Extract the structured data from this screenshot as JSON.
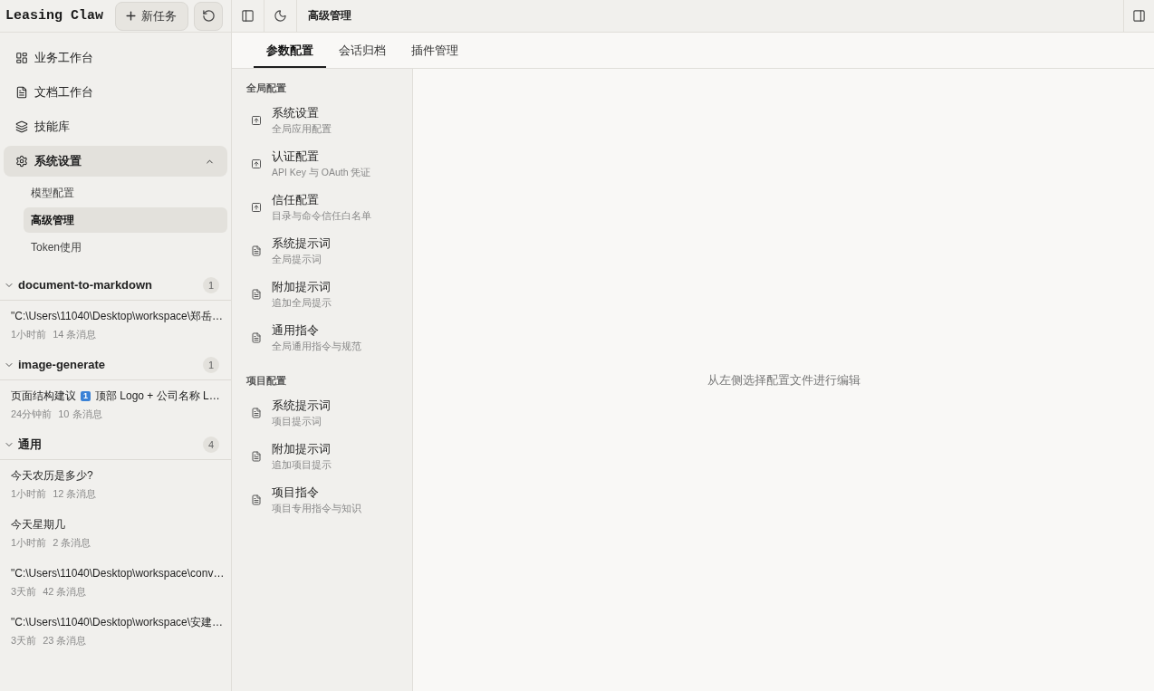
{
  "app_header": {
    "title": "Leasing Claw",
    "new_task_button": "新任务"
  },
  "toolbar": {
    "title": "高级管理"
  },
  "nav": [
    {
      "label": "业务工作台",
      "selected": false
    },
    {
      "label": "文档工作台",
      "selected": false
    },
    {
      "label": "技能库",
      "selected": false
    },
    {
      "label": "系统设置",
      "selected": true,
      "expanded": true,
      "children": [
        {
          "label": "模型配置",
          "selected": false
        },
        {
          "label": "高级管理",
          "selected": true
        },
        {
          "label": "Token使用",
          "selected": false
        }
      ]
    }
  ],
  "session_groups": [
    {
      "name": "document-to-markdown",
      "count": "1",
      "expanded": true,
      "sessions": [
        {
          "title": "\"C:\\Users\\11040\\Desktop\\workspace\\郑岳…",
          "time": "1小时前",
          "messages": "14 条消息"
        }
      ]
    },
    {
      "name": "image-generate",
      "count": "1",
      "expanded": true,
      "sessions": [
        {
          "title_parts": [
            {
              "kind": "text",
              "text": "页面结构建议"
            },
            {
              "kind": "keycap",
              "text": "1"
            },
            {
              "kind": "text",
              "text": "顶部 Logo + 公司名称 L…"
            }
          ],
          "time": "24分钟前",
          "messages": "10 条消息"
        }
      ]
    },
    {
      "name": "通用",
      "count": "4",
      "expanded": true,
      "sessions": [
        {
          "title": "今天农历是多少?",
          "time": "1小时前",
          "messages": "12 条消息"
        },
        {
          "title": "今天星期几",
          "time": "1小时前",
          "messages": "2 条消息"
        },
        {
          "title": "\"C:\\Users\\11040\\Desktop\\workspace\\conv…",
          "time": "3天前",
          "messages": "42 条消息"
        },
        {
          "title": "\"C:\\Users\\11040\\Desktop\\workspace\\安建…",
          "time": "3天前",
          "messages": "23 条消息"
        }
      ]
    }
  ],
  "tabs": [
    {
      "label": "参数配置",
      "selected": true
    },
    {
      "label": "会话归档",
      "selected": false
    },
    {
      "label": "插件管理",
      "selected": false
    }
  ],
  "config_sections": [
    {
      "title": "全局配置",
      "items": [
        {
          "kind": "linked",
          "title": "系统设置",
          "subtitle": "全局应用配置"
        },
        {
          "kind": "linked",
          "title": "认证配置",
          "subtitle": "API Key 与 OAuth 凭证"
        },
        {
          "kind": "linked",
          "title": "信任配置",
          "subtitle": "目录与命令信任白名单"
        },
        {
          "kind": "file",
          "title": "系统提示词",
          "subtitle": "全局提示词"
        },
        {
          "kind": "file",
          "title": "附加提示词",
          "subtitle": "追加全局提示"
        },
        {
          "kind": "file",
          "title": "通用指令",
          "subtitle": "全局通用指令与规范"
        }
      ]
    },
    {
      "title": "项目配置",
      "items": [
        {
          "kind": "file",
          "title": "系统提示词",
          "subtitle": "项目提示词"
        },
        {
          "kind": "file",
          "title": "附加提示词",
          "subtitle": "追加项目提示"
        },
        {
          "kind": "file",
          "title": "项目指令",
          "subtitle": "项目专用指令与知识"
        }
      ]
    }
  ],
  "editor": {
    "empty_hint": "从左侧选择配置文件进行编辑"
  }
}
